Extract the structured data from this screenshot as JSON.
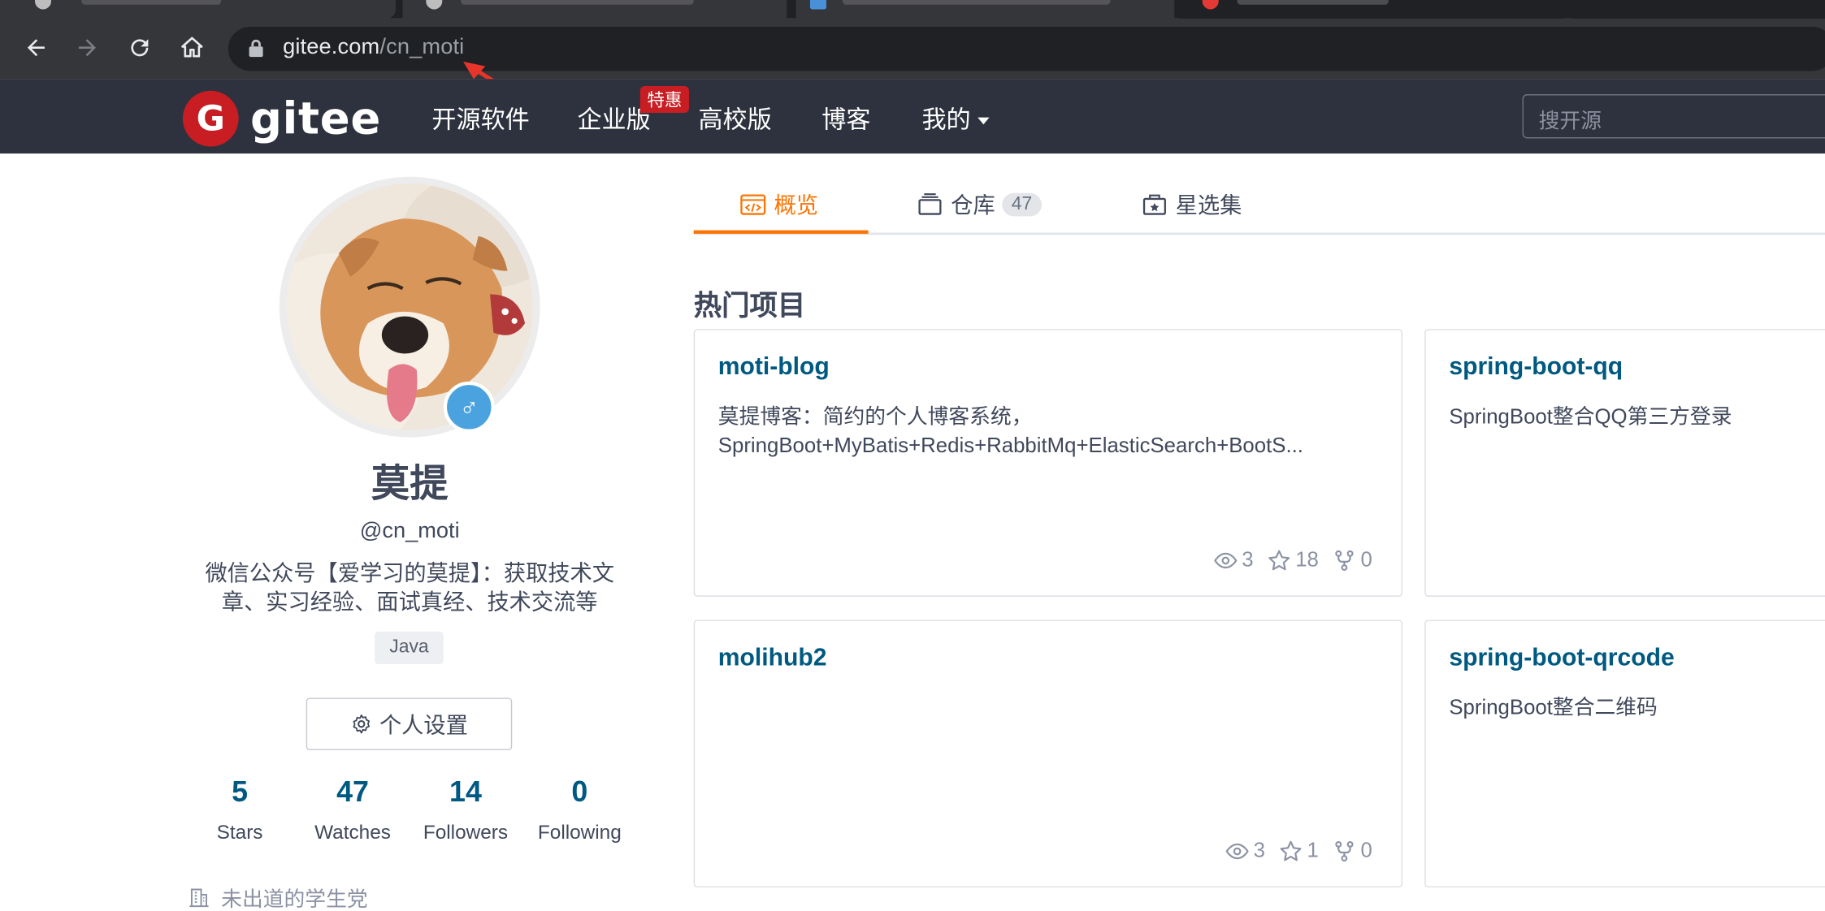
{
  "browser": {
    "url_domain": "gitee.com",
    "url_path": "/cn_moti"
  },
  "header": {
    "logo_text": "gitee",
    "logo_letter": "G",
    "menu": [
      "开源软件",
      "企业版",
      "高校版",
      "博客",
      "我的"
    ],
    "special_badge": "特惠",
    "search_placeholder": "搜开源"
  },
  "profile": {
    "display_name": "莫提",
    "handle": "@cn_moti",
    "bio": "微信公众号【爱学习的莫提】：获取技术文章、实习经验、面试真经、技术交流等",
    "tag": "Java",
    "settings_label": "个人设置",
    "gender_icon": "♂",
    "stats": [
      {
        "value": "5",
        "label": "Stars"
      },
      {
        "value": "47",
        "label": "Watches"
      },
      {
        "value": "14",
        "label": "Followers"
      },
      {
        "value": "0",
        "label": "Following"
      }
    ],
    "organization": "未出道的学生党"
  },
  "tabs": [
    {
      "label": "概览",
      "active": true
    },
    {
      "label": "仓库",
      "count": "47"
    },
    {
      "label": "星选集"
    }
  ],
  "section_title": "热门项目",
  "projects": [
    {
      "name": "moti-blog",
      "desc_line1": "莫提博客：简约的个人博客系统，",
      "desc_line2": "SpringBoot+MyBatis+Redis+RabbitMq+ElasticSearch+BootS...",
      "watch": "3",
      "star": "18",
      "fork": "0"
    },
    {
      "name": "spring-boot-qq",
      "desc_line1": "SpringBoot整合QQ第三方登录",
      "desc_line2": ""
    },
    {
      "name": "molihub2",
      "desc_line1": "",
      "desc_line2": "",
      "watch": "3",
      "star": "1",
      "fork": "0"
    },
    {
      "name": "spring-boot-qrcode",
      "desc_line1": "SpringBoot整合二维码",
      "desc_line2": ""
    }
  ],
  "colors": {
    "brand_red": "#c71d23",
    "header_bg": "#2e323e",
    "accent_orange": "#fe7300",
    "link_blue": "#005980"
  }
}
